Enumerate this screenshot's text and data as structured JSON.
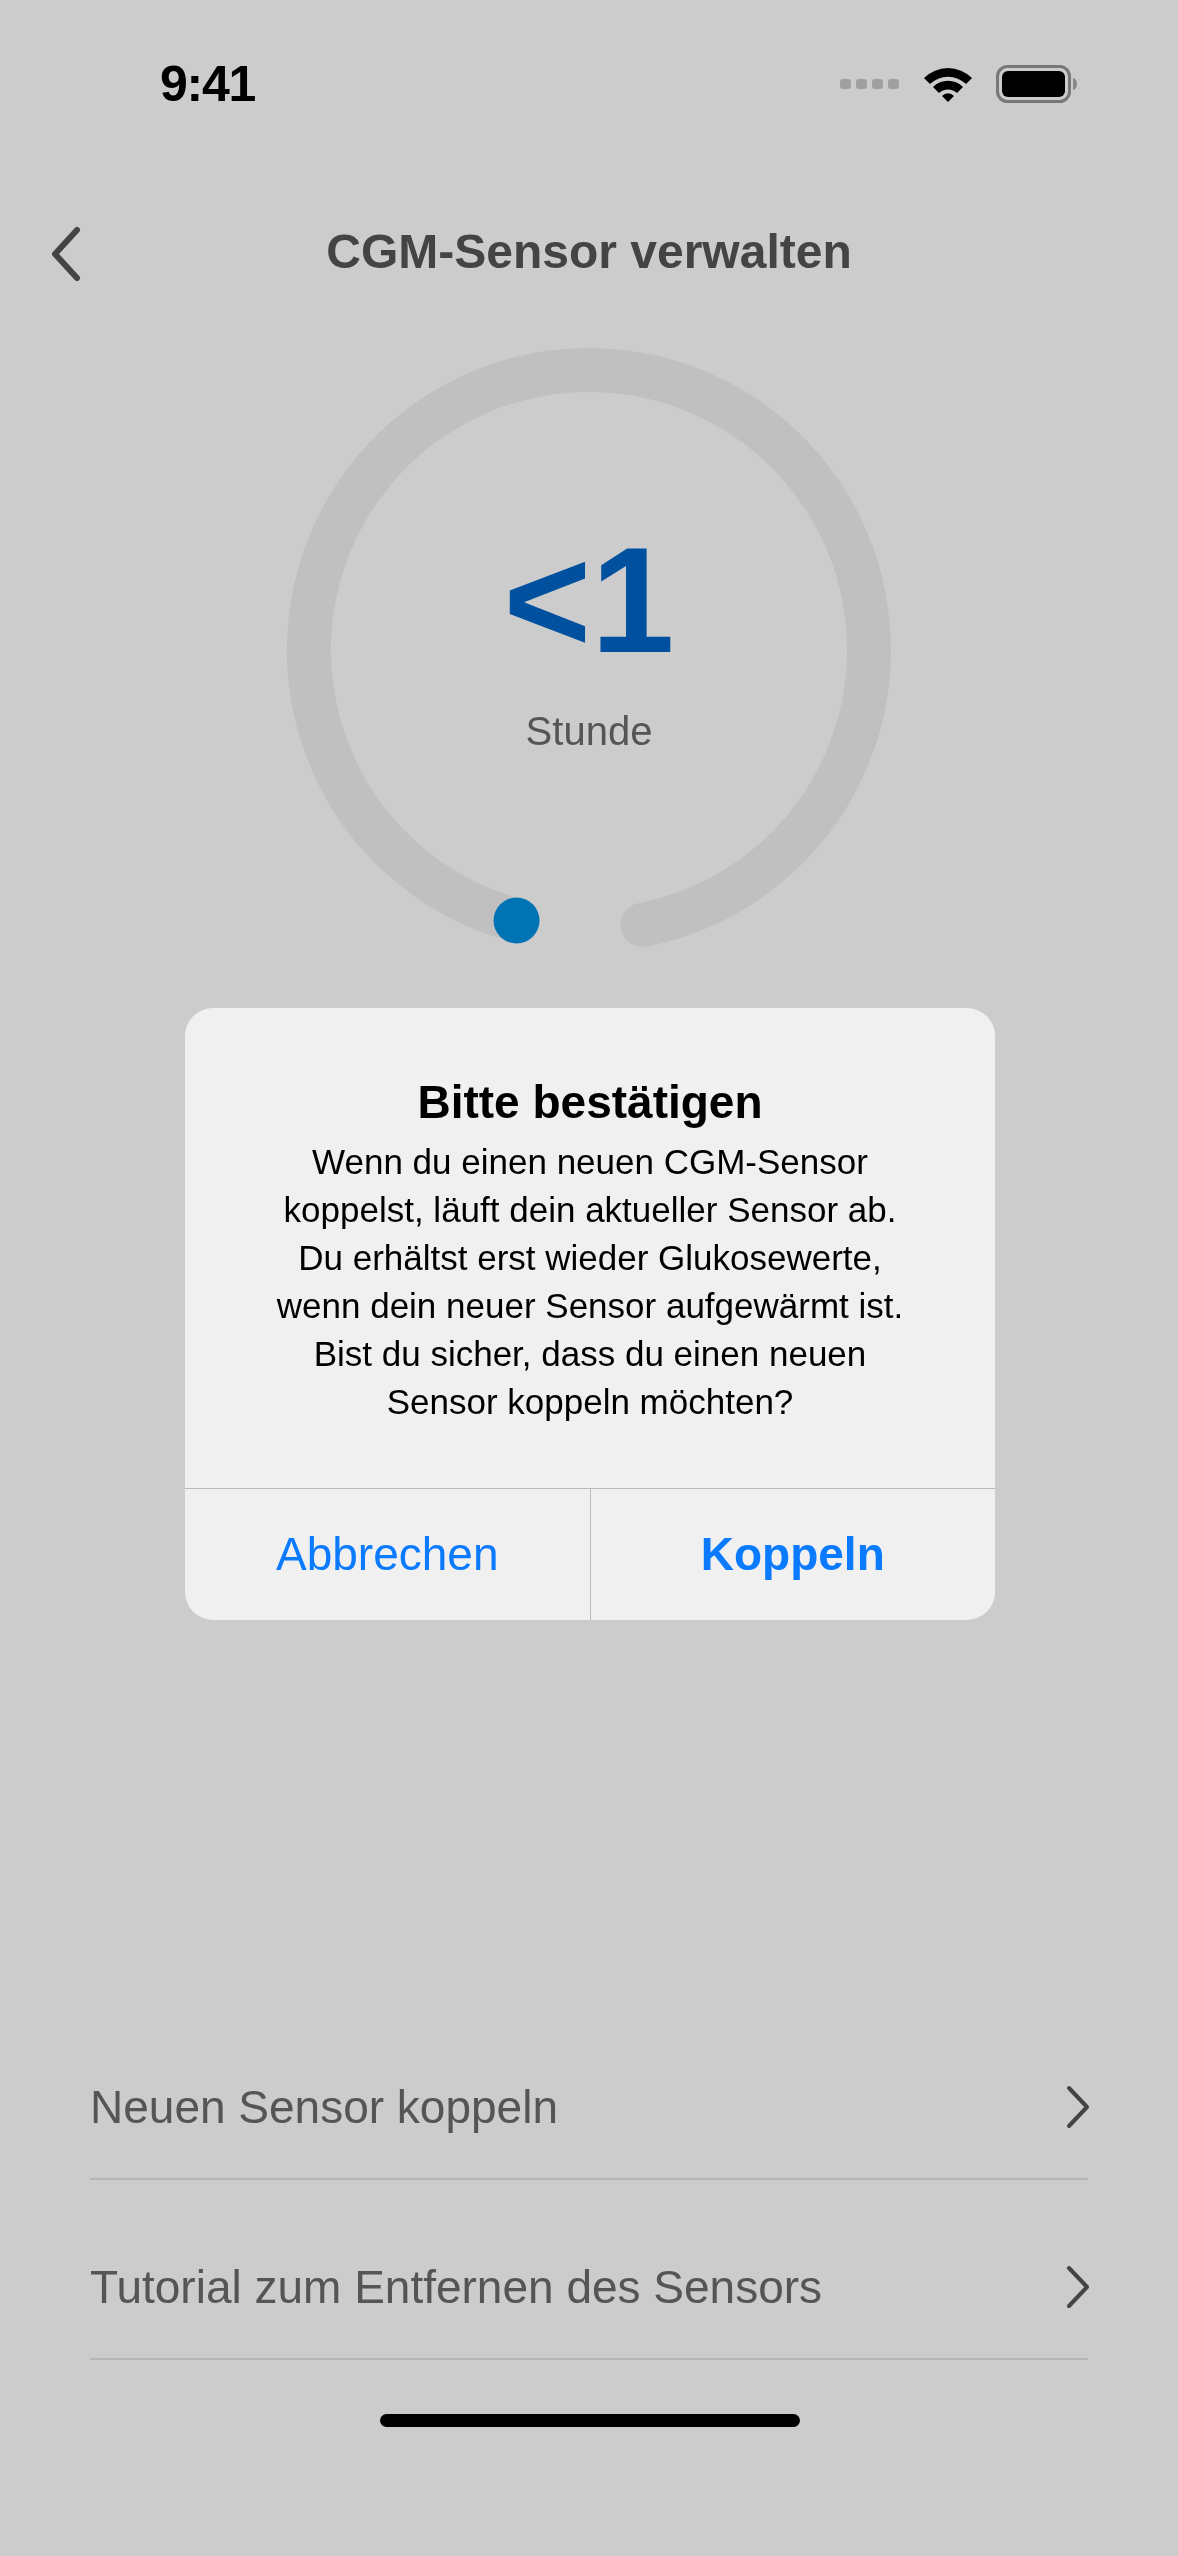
{
  "status_bar": {
    "time": "9:41"
  },
  "nav": {
    "title": "CGM-Sensor verwalten"
  },
  "gauge": {
    "value": "<1",
    "unit": "Stunde"
  },
  "menu": [
    {
      "label": "Neuen Sensor koppeln"
    },
    {
      "label": "Tutorial zum Entfernen des Sensors"
    }
  ],
  "dialog": {
    "title": "Bitte bestätigen",
    "message": "Wenn du einen neuen CGM-Sensor koppelst, läuft dein aktueller Sensor ab. Du erhältst erst wieder Glukosewerte, wenn dein neuer Sensor aufgewärmt ist. Bist du sicher, dass du einen neuen Sensor koppeln möchten?",
    "buttons": [
      {
        "label": "Abbrechen",
        "kind": "cancel"
      },
      {
        "label": "Koppeln",
        "kind": "default"
      }
    ]
  }
}
